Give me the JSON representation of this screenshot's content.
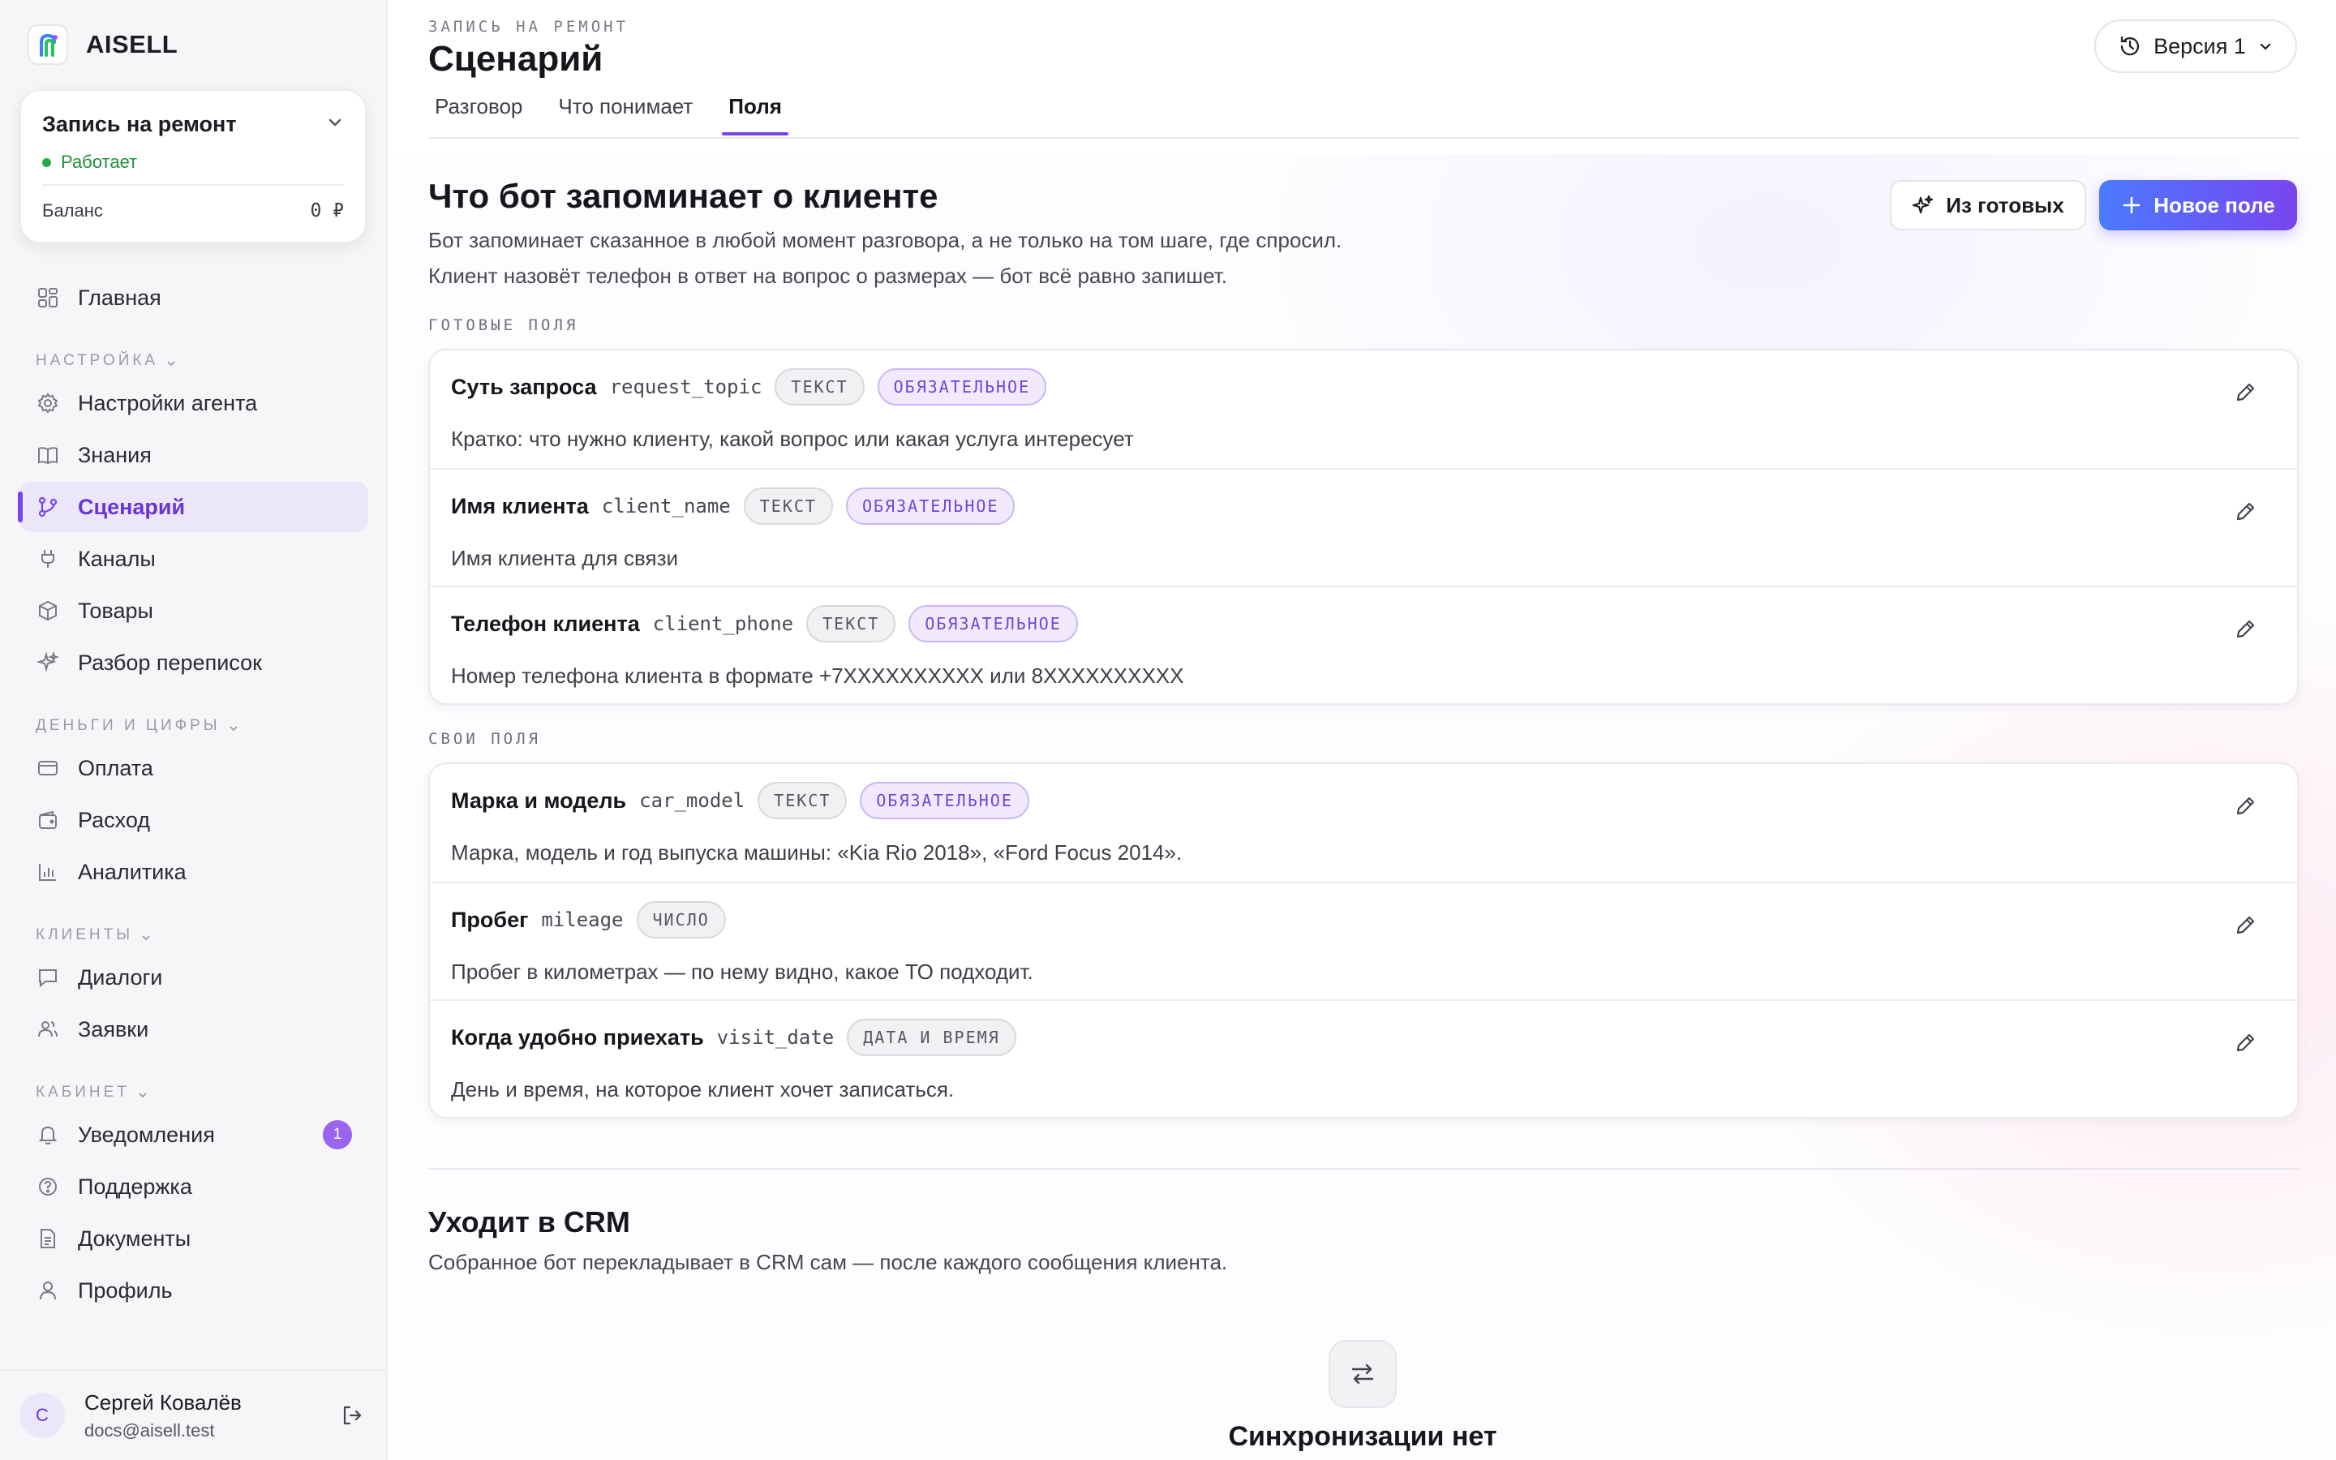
{
  "brand": {
    "name": "AISELL"
  },
  "agent": {
    "name": "Запись на ремонт",
    "status": "Работает",
    "balance_label": "Баланс",
    "balance_value": "0 ₽"
  },
  "nav": {
    "home": "Главная",
    "section_setup": "НАСТРОЙКА",
    "agent_settings": "Настройки агента",
    "knowledge": "Знания",
    "scenario": "Сценарий",
    "channels": "Каналы",
    "goods": "Товары",
    "review": "Разбор переписок",
    "section_money": "ДЕНЬГИ И ЦИФРЫ",
    "payment": "Оплата",
    "expense": "Расход",
    "analytics": "Аналитика",
    "section_clients": "КЛИЕНТЫ",
    "dialogs": "Диалоги",
    "requests": "Заявки",
    "section_cabinet": "КАБИНЕТ",
    "notifications": "Уведомления",
    "notifications_count": "1",
    "support": "Поддержка",
    "documents": "Документы",
    "profile": "Профиль"
  },
  "user": {
    "initial": "С",
    "name": "Сергей Ковалёв",
    "email": "docs@aisell.test"
  },
  "header": {
    "eyebrow": "ЗАПИСЬ НА РЕМОНТ",
    "title": "Сценарий",
    "version": "Версия 1",
    "tabs": [
      "Разговор",
      "Что понимает",
      "Поля"
    ],
    "active_tab": "Поля"
  },
  "memory": {
    "title": "Что бот запоминает о клиенте",
    "desc_1": "Бот запоминает сказанное в любой момент разговора, а не только на том шаге, где спросил.",
    "desc_2": "Клиент назовёт телефон в ответ на вопрос о размерах — бот всё равно запишет.",
    "btn_ready": "Из готовых",
    "btn_new": "Новое поле"
  },
  "ready_fields": {
    "label": "ГОТОВЫЕ ПОЛЯ",
    "items": [
      {
        "name": "Суть запроса",
        "key": "request_topic",
        "type": "ТЕКСТ",
        "required": "ОБЯЗАТЕЛЬНОЕ",
        "desc": "Кратко: что нужно клиенту, какой вопрос или какая услуга интересует"
      },
      {
        "name": "Имя клиента",
        "key": "client_name",
        "type": "ТЕКСТ",
        "required": "ОБЯЗАТЕЛЬНОЕ",
        "desc": "Имя клиента для связи"
      },
      {
        "name": "Телефон клиента",
        "key": "client_phone",
        "type": "ТЕКСТ",
        "required": "ОБЯЗАТЕЛЬНОЕ",
        "desc": "Номер телефона клиента в формате +7XXXXXXXXXX или 8XXXXXXXXXX"
      }
    ]
  },
  "custom_fields": {
    "label": "СВОИ ПОЛЯ",
    "items": [
      {
        "name": "Марка и модель",
        "key": "car_model",
        "type": "ТЕКСТ",
        "required": "ОБЯЗАТЕЛЬНОЕ",
        "desc": "Марка, модель и год выпуска машины: «Kia Rio 2018», «Ford Focus 2014»."
      },
      {
        "name": "Пробег",
        "key": "mileage",
        "type": "ЧИСЛО",
        "desc": "Пробег в километрах — по нему видно, какое ТО подходит."
      },
      {
        "name": "Когда удобно приехать",
        "key": "visit_date",
        "type": "ДАТА И ВРЕМЯ",
        "desc": "День и время, на которое клиент хочет записаться."
      }
    ]
  },
  "crm": {
    "title": "Уходит в CRM",
    "desc": "Собранное бот перекладывает в CRM сам — после каждого сообщения клиента.",
    "empty_title": "Синхронизации нет"
  },
  "colors": {
    "accent": "#7b43f0",
    "active_bg": "#ece6fb",
    "status_green": "#1fae44"
  }
}
